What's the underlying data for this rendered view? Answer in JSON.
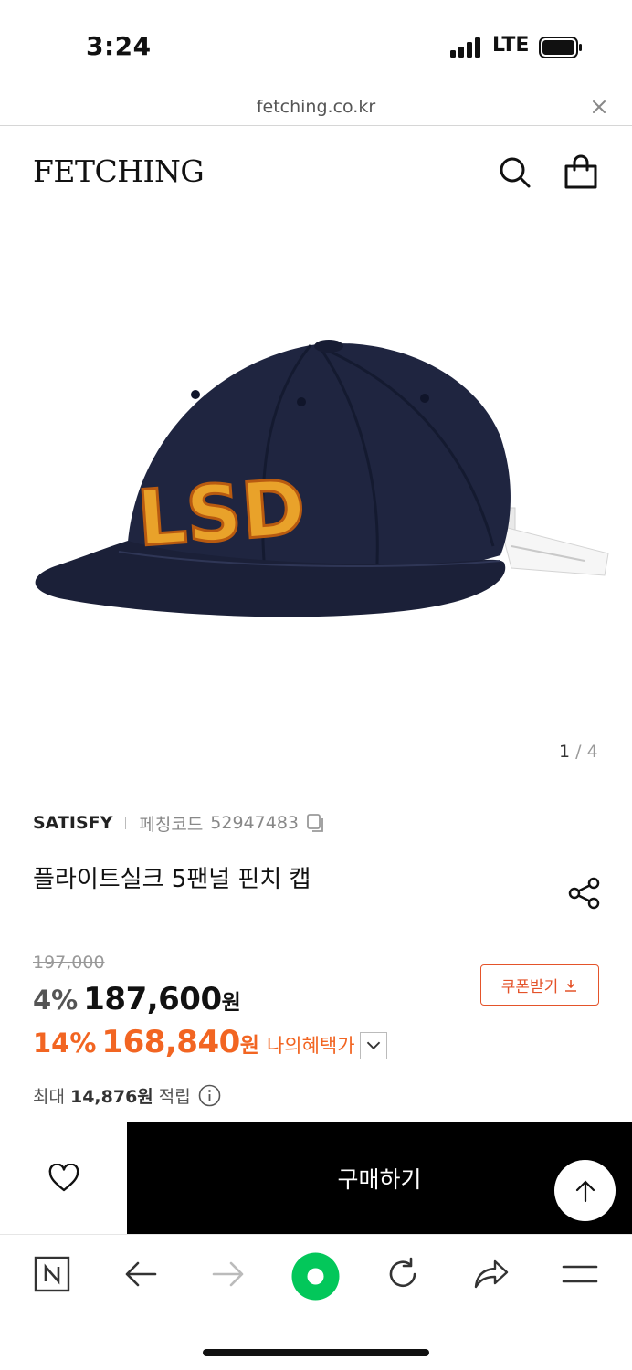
{
  "status_bar": {
    "time": "3:24",
    "network": "LTE"
  },
  "browser": {
    "url": "fetching.co.kr"
  },
  "header": {
    "logo": "FETCHING"
  },
  "gallery": {
    "current": "1",
    "separator": " / ",
    "total": "4",
    "image_text": "LSD"
  },
  "product": {
    "brand": "SATISFY",
    "code_label": "페칭코드",
    "code": "52947483",
    "title": "플라이트실크 5팬널 핀치 캡"
  },
  "pricing": {
    "original_price": "197,000",
    "discount_pct": "4%",
    "price": "187,600",
    "won": "원",
    "coupon_label": "쿠폰받기",
    "my_discount_pct": "14%",
    "my_price": "168,840",
    "my_benefit_label": "나의혜택가",
    "points_prefix": "최대",
    "points_value": "14,876원",
    "points_suffix": "적립"
  },
  "buy_bar": {
    "buy_label": "구매하기"
  },
  "colors": {
    "accent": "#f26522",
    "coupon": "#e4532a",
    "dark": "#000000",
    "naver_green": "#03c75a"
  },
  "icons": [
    "search-icon",
    "bag-icon",
    "close-icon",
    "copy-icon",
    "share-icon",
    "download-icon",
    "chevron-down-icon",
    "info-icon",
    "heart-icon",
    "arrow-up-icon",
    "naver-n-icon",
    "back-arrow-icon",
    "forward-arrow-icon",
    "green-dot-icon",
    "reload-icon",
    "share-arrow-icon",
    "menu-icon"
  ]
}
